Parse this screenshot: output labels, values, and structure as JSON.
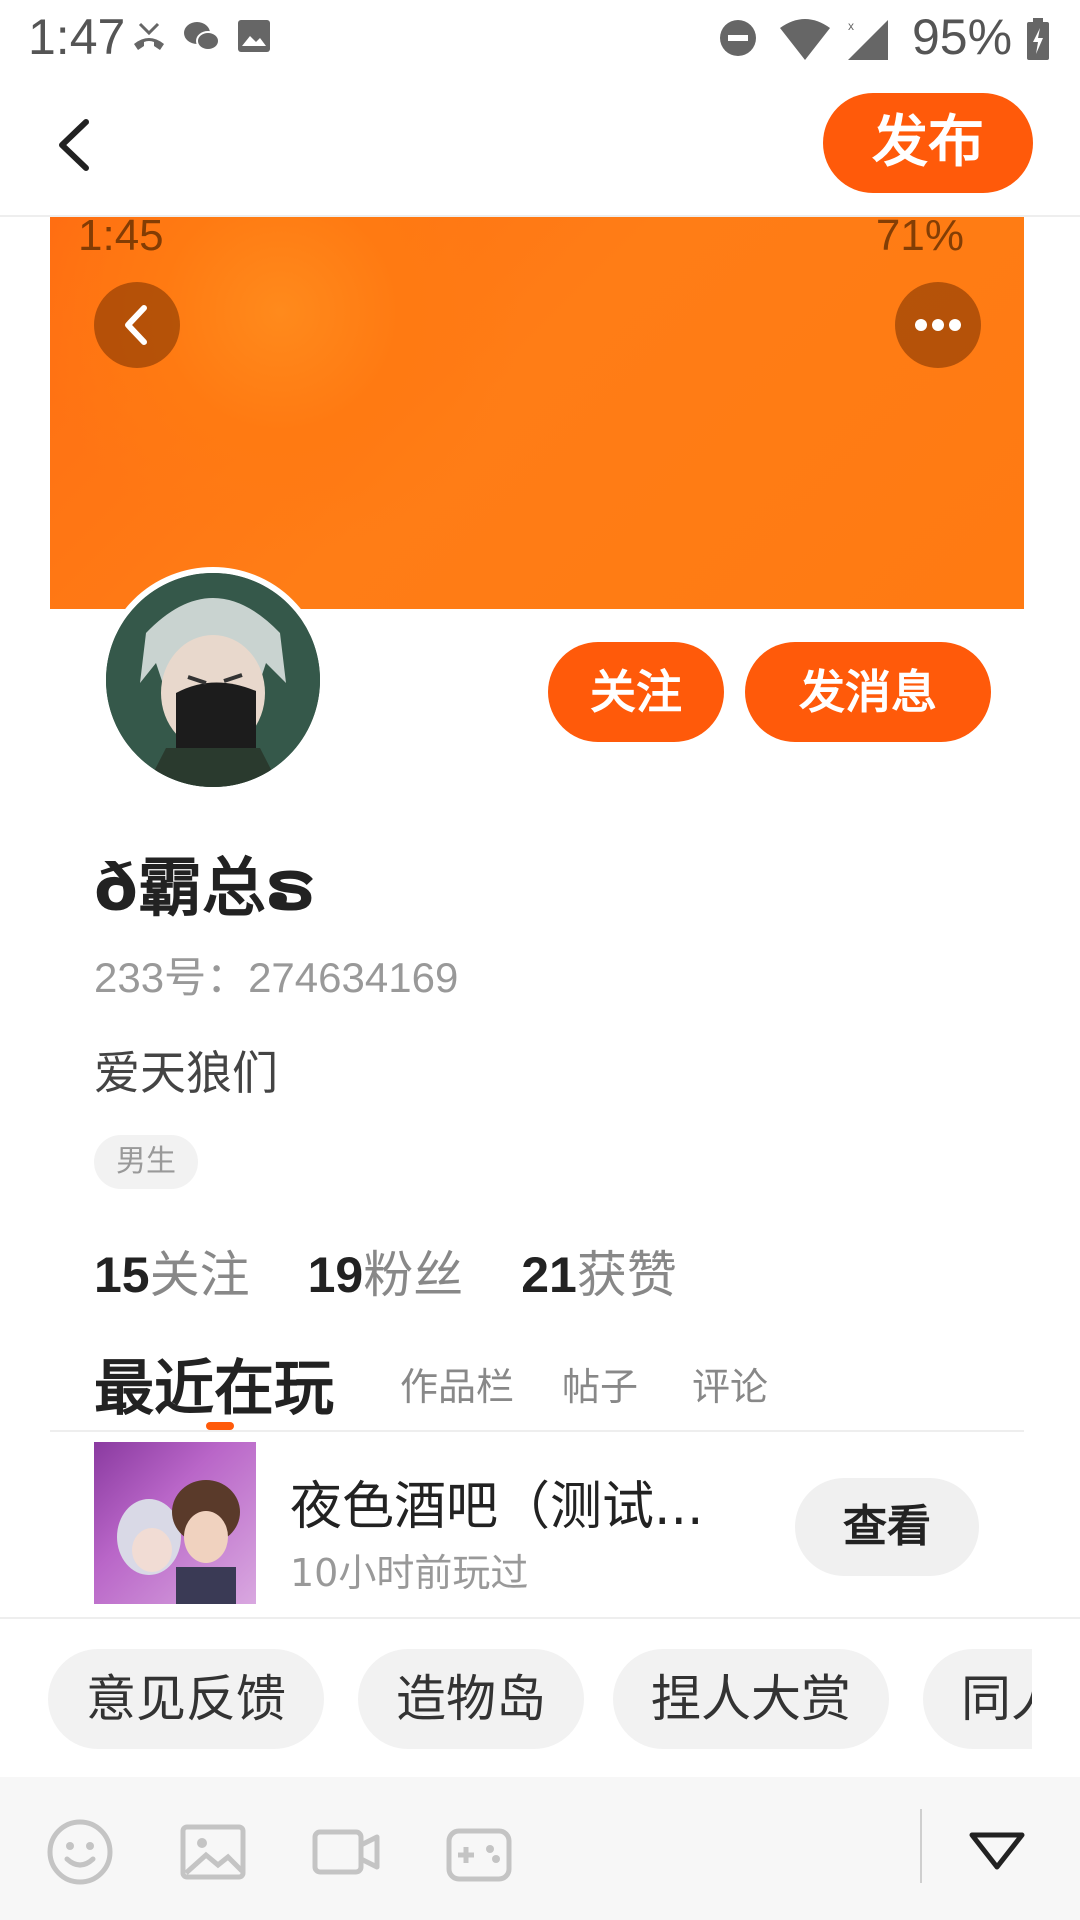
{
  "status_bar": {
    "time": "1:47",
    "battery": "95%",
    "icons": [
      "missed-call-icon",
      "wechat-icon",
      "image-icon",
      "do-not-disturb-icon",
      "wifi-icon",
      "signal-icon",
      "battery-icon"
    ]
  },
  "nav": {
    "back_icon": "back-arrow-icon",
    "publish_label": "发布",
    "accent_color": "#ff5a0a"
  },
  "profile": {
    "inner_status": {
      "time": "1:45",
      "battery": "71%"
    },
    "follow_label": "关注",
    "message_label": "发消息",
    "username": "ð霸总ຣ",
    "user_id": "233号：274634169",
    "bio": "爱天狼们",
    "gender_tag": "男生",
    "stats": [
      {
        "number": "15",
        "label": "关注"
      },
      {
        "number": "19",
        "label": "粉丝"
      },
      {
        "number": "21",
        "label": "获赞"
      }
    ],
    "tabs": [
      {
        "label": "最近在玩"
      },
      {
        "label": "作品栏"
      },
      {
        "label": "帖子"
      },
      {
        "label": "评论"
      }
    ],
    "recent_game": {
      "title": "夜色酒吧（测试...",
      "time": "10小时前玩过",
      "view_label": "查看"
    }
  },
  "chips": [
    "意见反馈",
    "造物岛",
    "捏人大赏",
    "同人"
  ],
  "toolbar": {
    "icons": [
      "emoji-icon",
      "image-icon",
      "video-icon",
      "game-controller-icon"
    ],
    "collapse_icon": "triangle-down-icon"
  }
}
